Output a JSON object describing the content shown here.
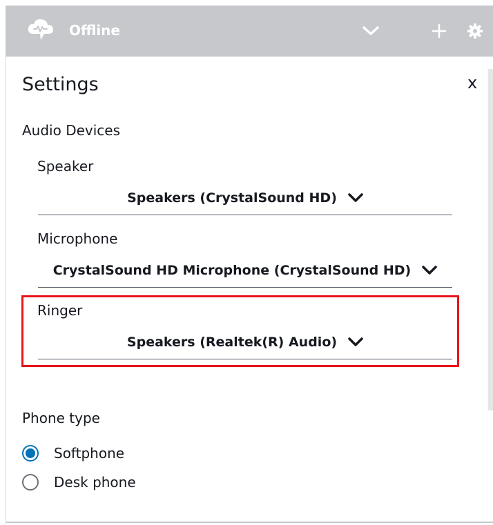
{
  "topbar": {
    "status": "Offline",
    "icons": {
      "logo": "cloud-phone-icon",
      "dropdown": "chevron-down-icon",
      "add": "plus-icon",
      "settings": "gear-icon"
    }
  },
  "settings": {
    "title": "Settings",
    "close_label": "x",
    "audio_devices_label": "Audio Devices",
    "speaker": {
      "label": "Speaker",
      "value": "Speakers (CrystalSound HD)"
    },
    "microphone": {
      "label": "Microphone",
      "value": "CrystalSound HD Microphone (CrystalSound HD)"
    },
    "ringer": {
      "label": "Ringer",
      "value": "Speakers (Realtek(R) Audio)"
    },
    "phone_type": {
      "label": "Phone type",
      "options": [
        {
          "label": "Softphone",
          "checked": true
        },
        {
          "label": "Desk phone",
          "checked": false
        }
      ]
    }
  },
  "colors": {
    "topbar_bg": "#c6c8cc",
    "highlight": "#e8141a",
    "radio_accent": "#0073bb"
  }
}
